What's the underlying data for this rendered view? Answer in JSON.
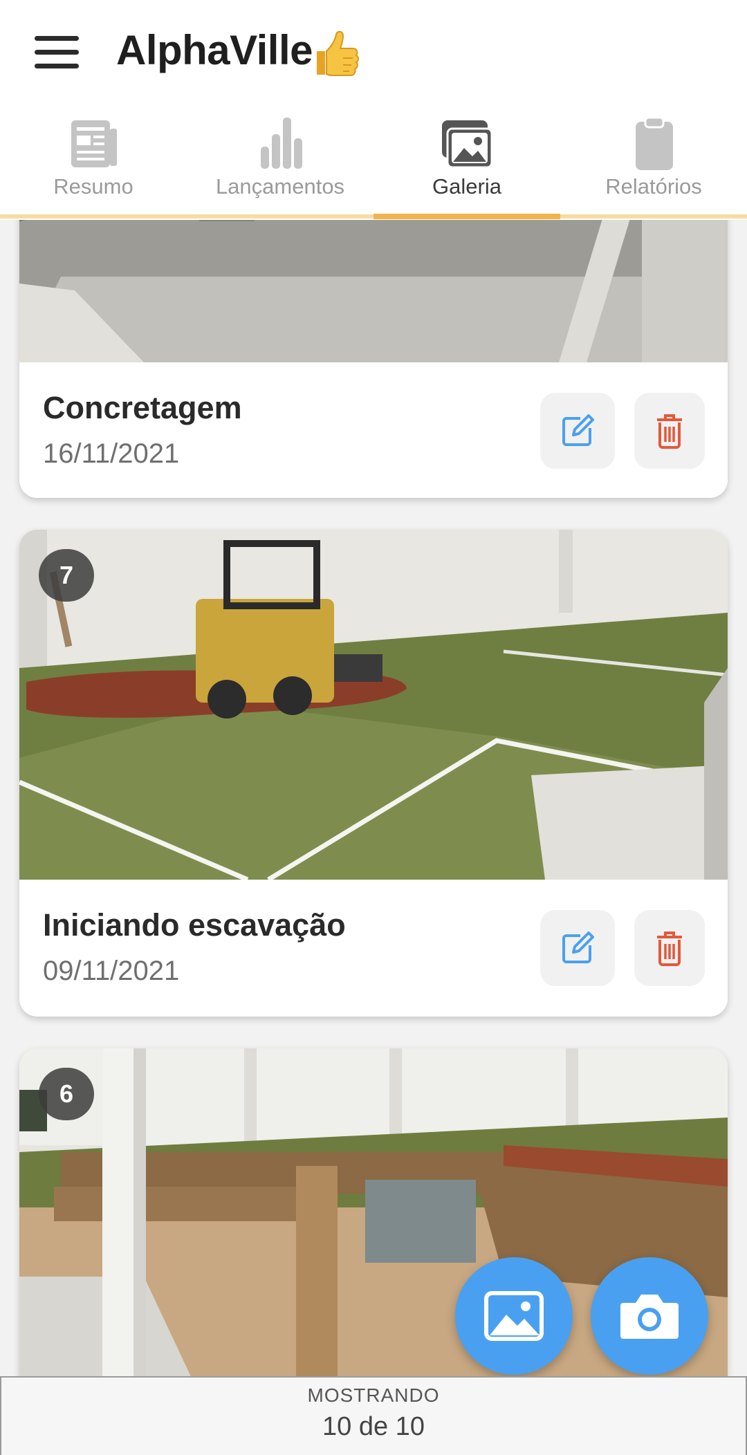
{
  "header": {
    "title": "AlphaVille",
    "title_emoji_icon": "thumbs-up-icon",
    "menu_icon": "hamburger-menu-icon"
  },
  "tabs": [
    {
      "label": "Resumo",
      "icon": "newspaper-icon",
      "active": false
    },
    {
      "label": "Lançamentos",
      "icon": "bar-chart-icon",
      "active": false
    },
    {
      "label": "Galeria",
      "icon": "gallery-icon",
      "active": true
    },
    {
      "label": "Relatórios",
      "icon": "clipboard-icon",
      "active": false
    }
  ],
  "gallery": {
    "items": [
      {
        "title": "Concretagem",
        "date": "16/11/2021",
        "badge": ""
      },
      {
        "title": "Iniciando escavação",
        "date": "09/11/2021",
        "badge": "7"
      },
      {
        "title": "",
        "date": "",
        "badge": "6"
      }
    ]
  },
  "actions": {
    "edit_icon": "edit-icon",
    "delete_icon": "trash-icon"
  },
  "fabs": {
    "gallery_icon": "image-icon",
    "camera_icon": "camera-icon"
  },
  "footer": {
    "label": "MOSTRANDO",
    "count": "10 de 10"
  },
  "colors": {
    "accent": "#f1b44c",
    "accent_light": "#f7dca1",
    "fab": "#4aa0f0",
    "edit": "#4aa0f0",
    "delete": "#e4583a"
  }
}
